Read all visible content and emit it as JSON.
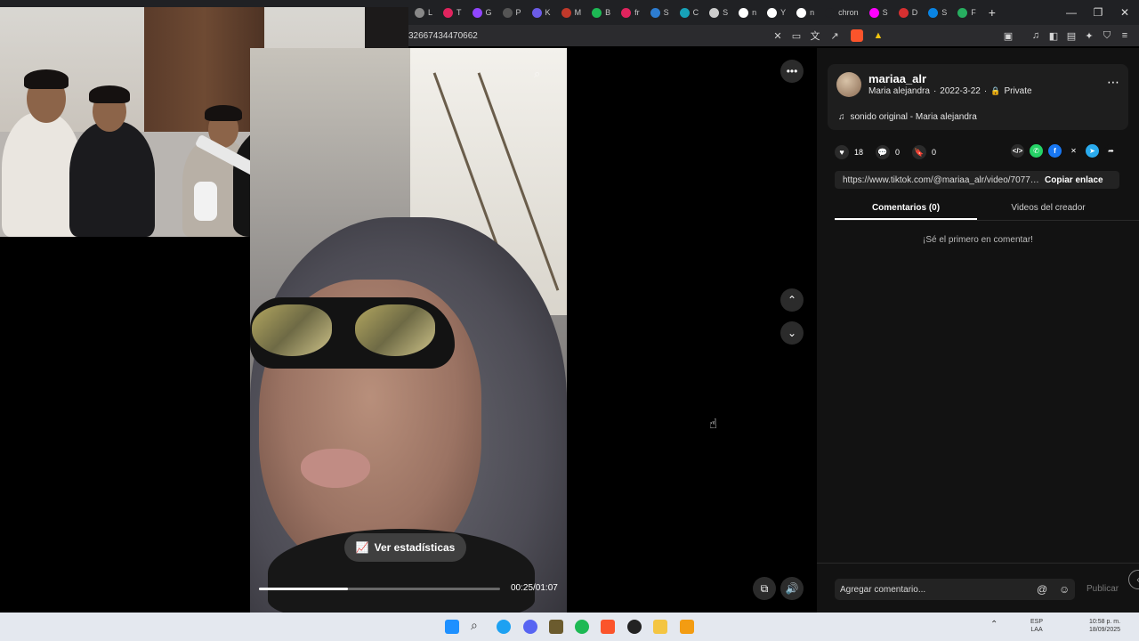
{
  "browser": {
    "tabs": [
      {
        "label": "L",
        "color": "#888888"
      },
      {
        "label": "T",
        "color": "#e0245e"
      },
      {
        "label": "G",
        "color": "#9146ff"
      },
      {
        "label": "P",
        "color": "#555555"
      },
      {
        "label": "K",
        "color": "#6c5ce7"
      },
      {
        "label": "M",
        "color": "#c0392b"
      },
      {
        "label": "B",
        "color": "#1db954"
      },
      {
        "label": "fr",
        "color": "#e0245e"
      },
      {
        "label": "S",
        "color": "#2d7dd2"
      },
      {
        "label": "C",
        "color": "#17a2b8"
      },
      {
        "label": "S",
        "color": "#cccccc"
      },
      {
        "label": "n",
        "color": "#ffffff"
      },
      {
        "label": "Y",
        "color": "#ffffff"
      },
      {
        "label": "n",
        "color": "#ffffff"
      },
      {
        "label": "chron",
        "color": "#202124"
      },
      {
        "label": "S",
        "color": "#ff00ff"
      },
      {
        "label": "D",
        "color": "#d63031"
      },
      {
        "label": "S",
        "color": "#0984e3"
      },
      {
        "label": "F",
        "color": "#27ae60"
      }
    ],
    "new_tab": "+",
    "url": "32667434470662",
    "window_controls": {
      "minimize": "—",
      "restore": "❐",
      "close": "✕"
    }
  },
  "video": {
    "stats_button": "Ver estadísticas",
    "time": "00:25/01:07",
    "progress": 0.37
  },
  "panel": {
    "username": "mariaa_alr",
    "display_name": "Maria alejandra",
    "date": "2022-3-22",
    "privacy": "Private",
    "sound": "sonido original - Maria alejandra",
    "likes": "18",
    "comments": "0",
    "saves": "0",
    "link": "https://www.tiktok.com/@mariaa_alr/video/707799...",
    "copy_link": "Copiar enlace",
    "tabs": {
      "comments": "Comentarios (0)",
      "creator_videos": "Videos del creador"
    },
    "empty_message": "¡Sé el primero en comentar!",
    "comment_placeholder": "Agregar comentario...",
    "publish": "Publicar"
  },
  "taskbar": {
    "lang_line1": "ESP",
    "lang_line2": "LAA",
    "time": "10:58 p. m.",
    "date": "18/09/2025"
  }
}
